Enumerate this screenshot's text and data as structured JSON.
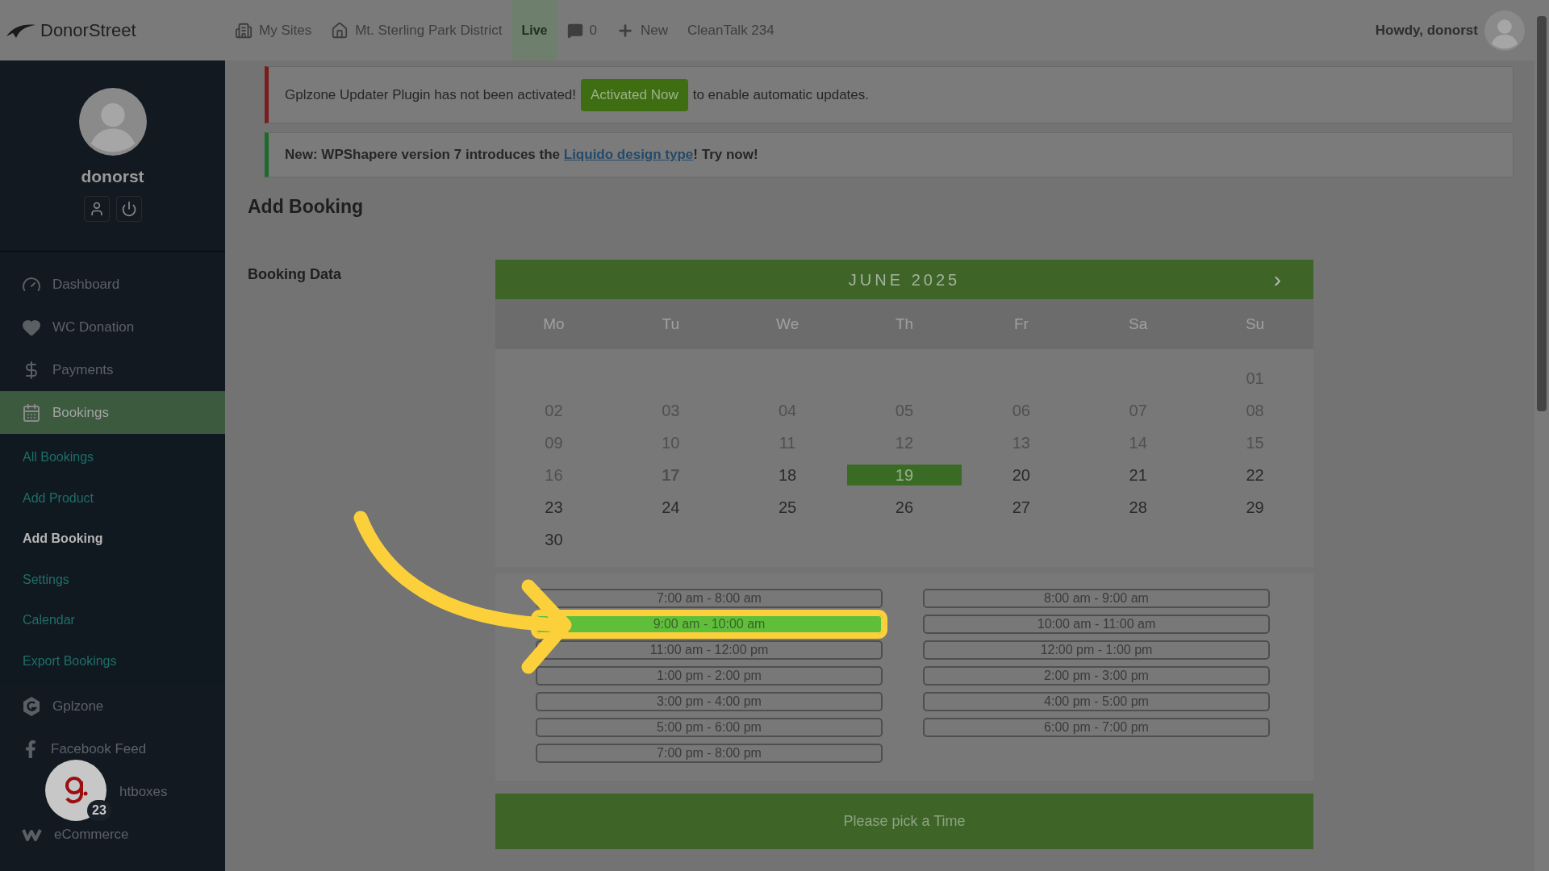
{
  "top_bar": {
    "logo": "DonorStreet",
    "items": [
      {
        "label": "My Sites",
        "kind": "sites"
      },
      {
        "label": "Mt. Sterling Park District",
        "kind": "home"
      },
      {
        "label": "Live",
        "kind": "badge"
      },
      {
        "label": "0",
        "kind": "comments"
      },
      {
        "label": "New",
        "kind": "new"
      },
      {
        "label": "CleanTalk 234",
        "kind": "plain"
      }
    ],
    "greeting": "Howdy, donorst"
  },
  "sidebar": {
    "username": "donorst",
    "menu": [
      {
        "label": "Dashboard",
        "selected": false
      },
      {
        "label": "WC Donation",
        "selected": false
      },
      {
        "label": "Payments",
        "selected": false
      },
      {
        "label": "Bookings",
        "selected": true,
        "children": [
          {
            "label": "All Bookings",
            "selected": false
          },
          {
            "label": "Add Product",
            "selected": false
          },
          {
            "label": "Add Booking",
            "selected": true
          },
          {
            "label": "Settings",
            "selected": false
          },
          {
            "label": "Calendar",
            "selected": false
          },
          {
            "label": "Export Bookings",
            "selected": false
          }
        ]
      },
      {
        "label": "Gplzone",
        "selected": false
      },
      {
        "label": "Facebook Feed",
        "selected": false
      },
      {
        "label": "htboxes",
        "selected": false
      },
      {
        "label": "eCommerce",
        "selected": false
      }
    ]
  },
  "chat_widget": {
    "count": "23"
  },
  "notices": [
    {
      "kind": "error",
      "before": "Gplzone Updater Plugin has not been activated!",
      "button": "Activated Now",
      "after": "to enable automatic updates."
    },
    {
      "kind": "success",
      "before": "New: WPShapere version 7 introduces the",
      "link": "Liquido design type",
      "after": "! Try now!"
    }
  ],
  "page_title": "Add Booking",
  "booking_label": "Booking Data",
  "calendar": {
    "month": "JUNE 2025",
    "next": "›",
    "weekdays": [
      "Mo",
      "Tu",
      "We",
      "Th",
      "Fr",
      "Sa",
      "Su"
    ],
    "weeks": [
      [
        {
          "label": "01",
          "disabled": true,
          "selected": false,
          "today": false
        }
      ],
      [
        {
          "label": "02",
          "disabled": true,
          "selected": false,
          "today": false
        },
        {
          "label": "03",
          "disabled": true,
          "selected": false,
          "today": false
        },
        {
          "label": "04",
          "disabled": true,
          "selected": false,
          "today": false
        },
        {
          "label": "05",
          "disabled": true,
          "selected": false,
          "today": false
        },
        {
          "label": "06",
          "disabled": true,
          "selected": false,
          "today": false
        },
        {
          "label": "07",
          "disabled": true,
          "selected": false,
          "today": false
        },
        {
          "label": "08",
          "disabled": true,
          "selected": false,
          "today": false
        }
      ],
      [
        {
          "label": "09",
          "disabled": true,
          "selected": false,
          "today": false
        },
        {
          "label": "10",
          "disabled": true,
          "selected": false,
          "today": false
        },
        {
          "label": "11",
          "disabled": true,
          "selected": false,
          "today": false
        },
        {
          "label": "12",
          "disabled": true,
          "selected": false,
          "today": false
        },
        {
          "label": "13",
          "disabled": true,
          "selected": false,
          "today": false
        },
        {
          "label": "14",
          "disabled": true,
          "selected": false,
          "today": false
        },
        {
          "label": "15",
          "disabled": true,
          "selected": false,
          "today": false
        }
      ],
      [
        {
          "label": "16",
          "disabled": true,
          "selected": false,
          "today": false
        },
        {
          "label": "17",
          "disabled": true,
          "selected": false,
          "today": true
        },
        {
          "label": "18",
          "disabled": false,
          "selected": false,
          "today": false
        },
        {
          "label": "19",
          "disabled": false,
          "selected": true,
          "today": false
        },
        {
          "label": "20",
          "disabled": false,
          "selected": false,
          "today": false
        },
        {
          "label": "21",
          "disabled": false,
          "selected": false,
          "today": false
        },
        {
          "label": "22",
          "disabled": false,
          "selected": false,
          "today": false
        }
      ],
      [
        {
          "label": "23",
          "disabled": false,
          "selected": false,
          "today": false
        },
        {
          "label": "24",
          "disabled": false,
          "selected": false,
          "today": false
        },
        {
          "label": "25",
          "disabled": false,
          "selected": false,
          "today": false
        },
        {
          "label": "26",
          "disabled": false,
          "selected": false,
          "today": false
        },
        {
          "label": "27",
          "disabled": false,
          "selected": false,
          "today": false
        },
        {
          "label": "28",
          "disabled": false,
          "selected": false,
          "today": false
        },
        {
          "label": "29",
          "disabled": false,
          "selected": false,
          "today": false
        }
      ],
      [
        {
          "label": "30",
          "disabled": false,
          "selected": false,
          "today": false
        }
      ]
    ]
  },
  "time_slots": [
    [
      {
        "label": "7:00 am - 8:00 am",
        "selected": false
      },
      {
        "label": "9:00 am - 10:00 am",
        "selected": true
      },
      {
        "label": "11:00 am - 12:00 pm",
        "selected": false
      },
      {
        "label": "1:00 pm - 2:00 pm",
        "selected": false
      },
      {
        "label": "3:00 pm - 4:00 pm",
        "selected": false
      },
      {
        "label": "5:00 pm - 6:00 pm",
        "selected": false
      },
      {
        "label": "7:00 pm - 8:00 pm",
        "selected": false
      }
    ],
    [
      {
        "label": "8:00 am - 9:00 am",
        "selected": false
      },
      {
        "label": "10:00 am - 11:00 am",
        "selected": false
      },
      {
        "label": "12:00 pm - 1:00 pm",
        "selected": false
      },
      {
        "label": "2:00 pm - 3:00 pm",
        "selected": false
      },
      {
        "label": "4:00 pm - 5:00 pm",
        "selected": false
      },
      {
        "label": "6:00 pm - 7:00 pm",
        "selected": false
      }
    ]
  ],
  "submit_button": "Please pick a Time"
}
